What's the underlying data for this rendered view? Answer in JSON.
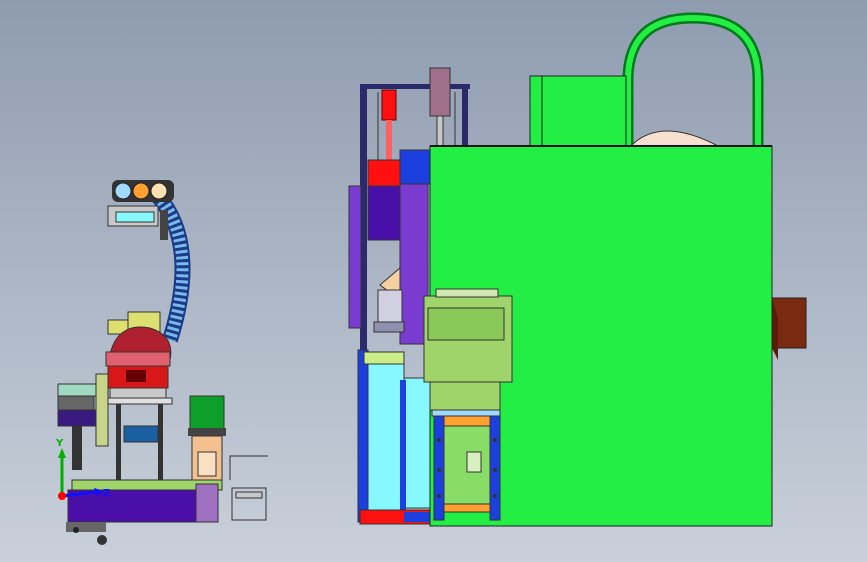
{
  "viewport": {
    "background_top": "#8f9cb0",
    "background_bottom": "#c9d0da"
  },
  "triad": {
    "y_label": "Y",
    "z_label": "Z",
    "y_color": "#00b000",
    "z_color": "#1010ff",
    "origin_color": "#ff0000"
  },
  "colors": {
    "enclosure_green": "#22ee44",
    "dark_green": "#007a1a",
    "purple": "#7a3bd0",
    "deep_purple": "#4a0fa8",
    "cyan": "#88f8ff",
    "blue": "#1c3fe0",
    "red": "#ff1010",
    "brown": "#7a2a10",
    "olive_green": "#9fd46a",
    "maroon": "#b0202e",
    "orange": "#ffa030",
    "light_blue": "#a0d8ff",
    "peach": "#f5c090"
  },
  "icons": {
    "triad": "coordinate-triad-icon",
    "view_cube": "none"
  }
}
